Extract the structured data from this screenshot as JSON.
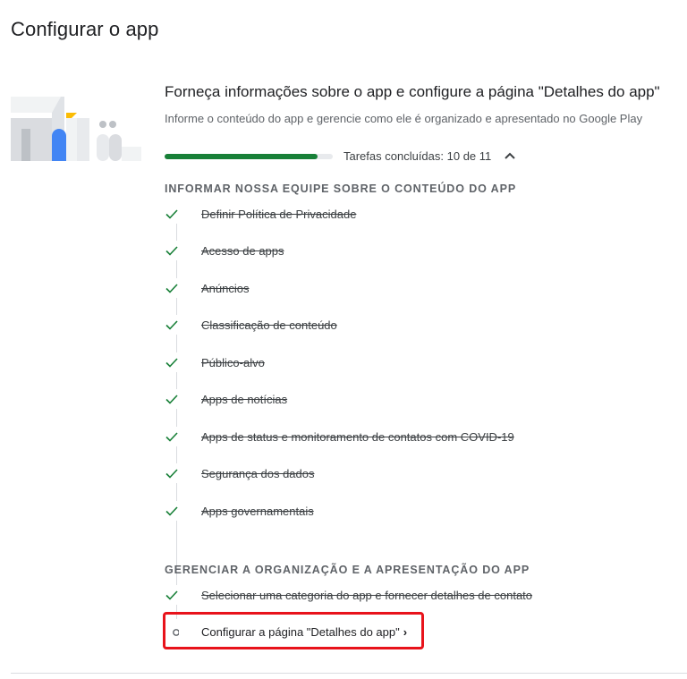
{
  "page": {
    "title": "Configurar o app"
  },
  "section": {
    "title": "Forneça informações sobre o app e configure a página \"Detalhes do app\"",
    "subtitle": "Informe o conteúdo do app e gerencie como ele é organizado e apresentado no Google Play",
    "progress_fraction": 0.909,
    "progress_label": "Tarefas concluídas: 10 de 11"
  },
  "groups": [
    {
      "heading": "INFORMAR NOSSA EQUIPE SOBRE O CONTEÚDO DO APP",
      "tasks": [
        {
          "label": "Definir Política de Privacidade",
          "done": true
        },
        {
          "label": "Acesso de apps",
          "done": true
        },
        {
          "label": "Anúncios",
          "done": true
        },
        {
          "label": "Classificação de conteúdo",
          "done": true
        },
        {
          "label": "Público-alvo",
          "done": true
        },
        {
          "label": "Apps de notícias",
          "done": true
        },
        {
          "label": "Apps de status e monitoramento de contatos com COVID-19",
          "done": true
        },
        {
          "label": "Segurança dos dados",
          "done": true
        },
        {
          "label": "Apps governamentais",
          "done": true
        }
      ]
    },
    {
      "heading": "GERENCIAR A ORGANIZAÇÃO E A APRESENTAÇÃO DO APP",
      "tasks": [
        {
          "label": "Selecionar uma categoria do app e fornecer detalhes de contato",
          "done": true
        },
        {
          "label": "Configurar a página \"Detalhes do app\"",
          "done": false,
          "arrow": "›"
        }
      ]
    }
  ],
  "colors": {
    "accent_green": "#188038",
    "highlight_red": "#e8131b",
    "illus_blue": "#4285f4",
    "illus_yellow": "#fbbc04"
  },
  "icons": {
    "done": "check-icon",
    "pending": "circle-outline-icon",
    "collapse": "chevron-up-icon"
  }
}
